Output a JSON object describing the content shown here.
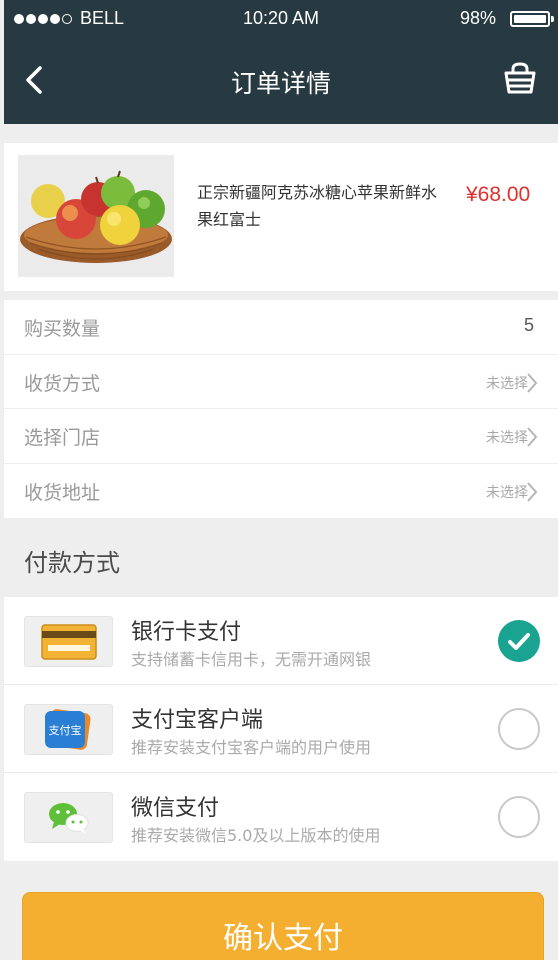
{
  "status_bar": {
    "carrier": "BELL",
    "time": "10:20 AM",
    "battery": "98%"
  },
  "nav": {
    "title": "订单详情",
    "back_icon": "chevron-left-icon",
    "right_icon": "basket-icon"
  },
  "product": {
    "name": "正宗新疆阿克苏冰糖心苹果新鲜水果红富士",
    "price": "¥68.00",
    "image": "fruit-basket-image"
  },
  "info_rows": [
    {
      "label": "购买数量",
      "value": "5"
    },
    {
      "label": "收货方式",
      "value": "未选择"
    },
    {
      "label": "选择门店",
      "value": "未选择"
    },
    {
      "label": "收货地址",
      "value": "未选择"
    }
  ],
  "payment": {
    "title": "付款方式",
    "methods": [
      {
        "name": "银行卡支付",
        "desc": "支持储蓄卡信用卡，无需开通网银",
        "icon": "bank-card-icon",
        "selected": true
      },
      {
        "name": "支付宝客户端",
        "desc": "推荐安装支付宝客户端的用户使用",
        "icon": "alipay-icon",
        "icon_text": "支付宝",
        "selected": false
      },
      {
        "name": "微信支付",
        "desc": "推荐安装微信5.0及以上版本的使用",
        "icon": "wechat-icon",
        "selected": false
      }
    ]
  },
  "confirm_label": "确认支付",
  "colors": {
    "header": "#283a41",
    "price": "#e0302e",
    "accent": "#1aa391",
    "confirm": "#f4af31"
  }
}
